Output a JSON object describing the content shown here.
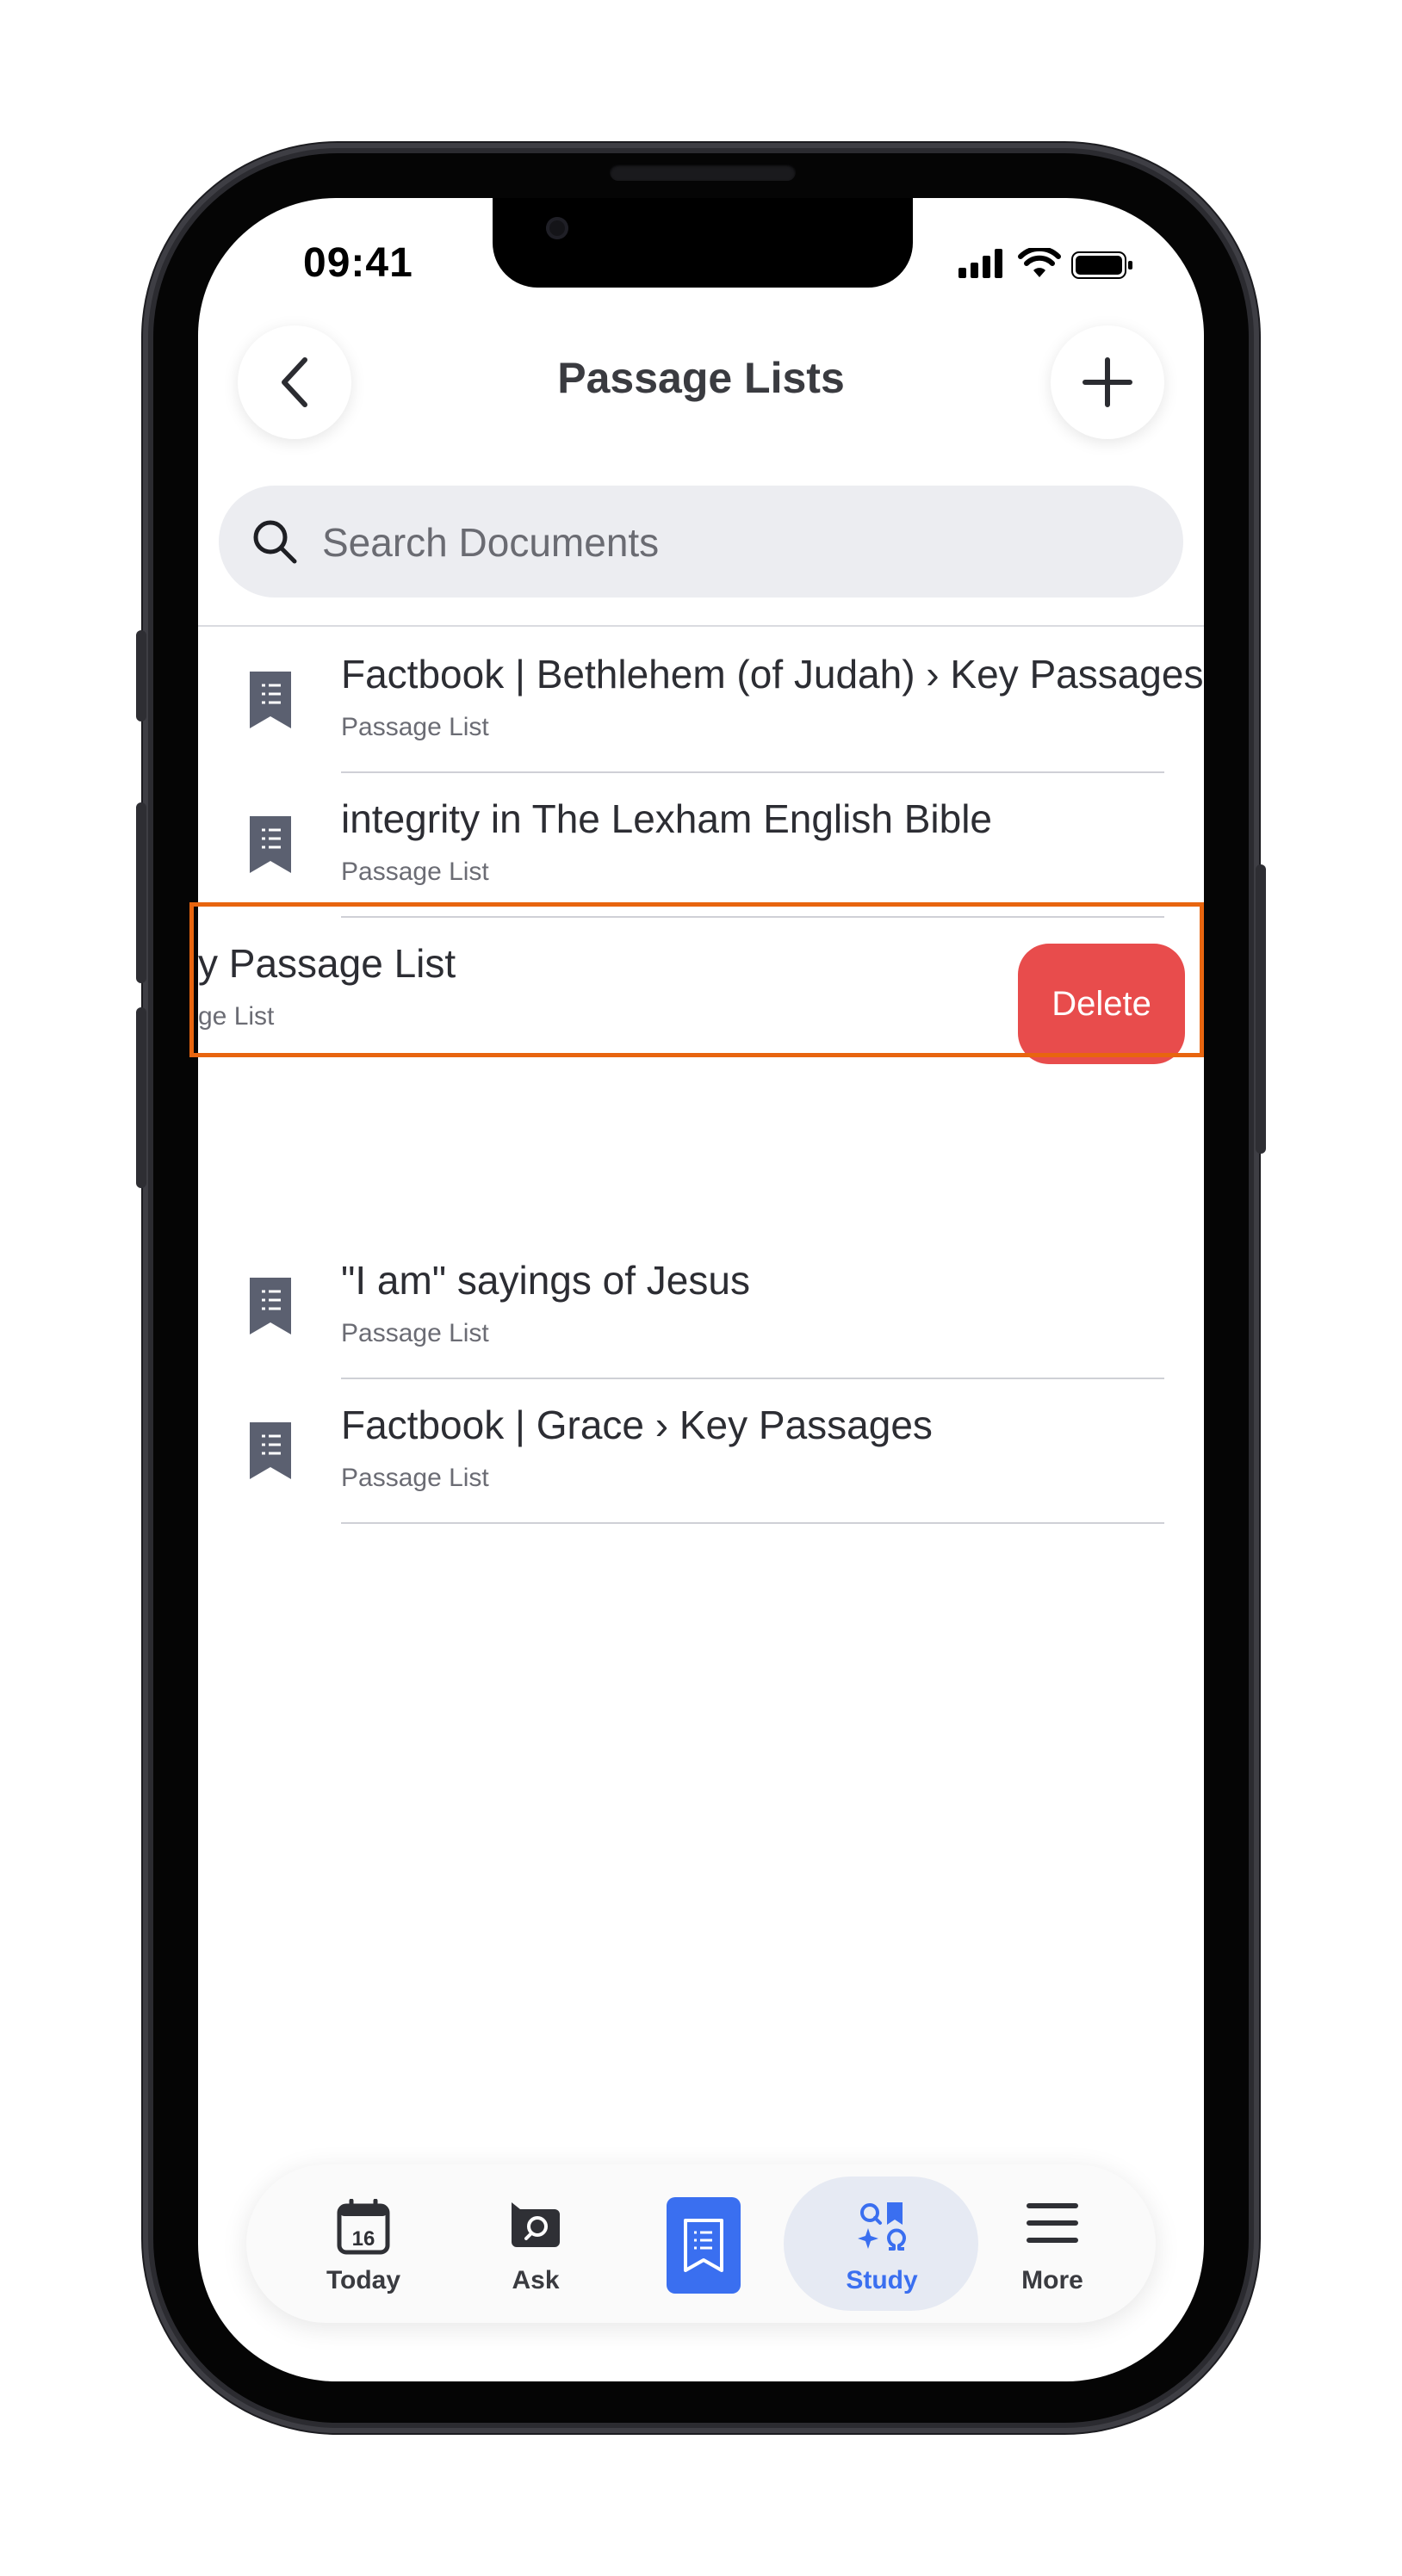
{
  "status_bar": {
    "time": "09:41"
  },
  "header": {
    "title": "Passage Lists",
    "back_icon": "chevron-left-icon",
    "add_icon": "plus-icon"
  },
  "search": {
    "placeholder": "Search Documents",
    "value": ""
  },
  "list": {
    "items": [
      {
        "title": "Factbook | Bethlehem (of Judah) › Key Passages",
        "subtitle": "Passage List",
        "icon": "passage-list-icon"
      },
      {
        "title": "integrity in The Lexham English Bible",
        "subtitle": "Passage List",
        "icon": "passage-list-icon"
      },
      {
        "title": "y Passage List",
        "subtitle": "ge List",
        "icon": "passage-list-icon",
        "swiped": true,
        "action_label": "Delete"
      },
      {
        "title": "\"I am\" sayings of Jesus",
        "subtitle": "Passage List",
        "icon": "passage-list-icon"
      },
      {
        "title": "Factbook | Grace › Key Passages",
        "subtitle": "Passage List",
        "icon": "passage-list-icon"
      }
    ]
  },
  "tabbar": {
    "tabs": [
      {
        "label": "Today",
        "icon": "calendar-icon",
        "badge": "16"
      },
      {
        "label": "Ask",
        "icon": "ask-search-icon"
      },
      {
        "label": "",
        "icon": "document-icon"
      },
      {
        "label": "Study",
        "icon": "study-icon",
        "selected": true
      },
      {
        "label": "More",
        "icon": "hamburger-menu-icon"
      }
    ]
  },
  "colors": {
    "accent": "#3a6ff0",
    "delete": "#e84c4c",
    "highlight": "#e8650f",
    "title_text": "#3a3b40",
    "icon_gray": "#5b6070"
  }
}
